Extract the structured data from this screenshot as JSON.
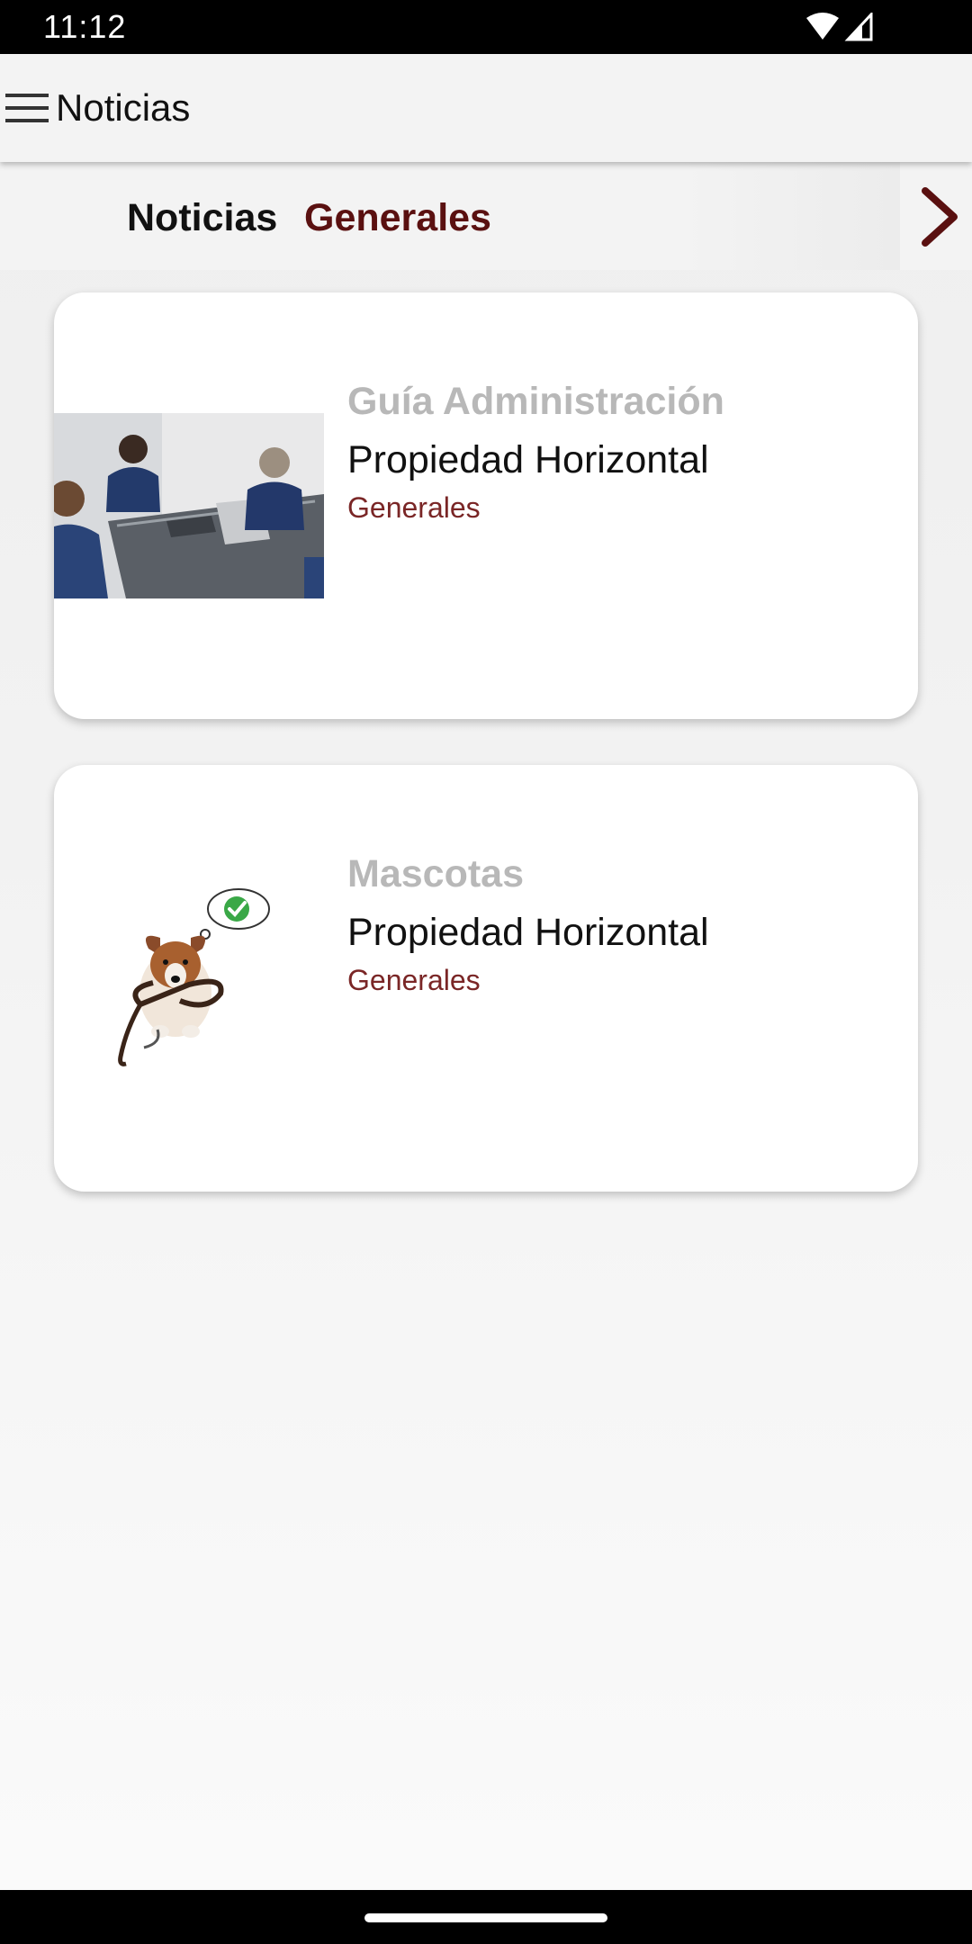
{
  "status_bar": {
    "time": "11:12",
    "icons": [
      "wifi-icon",
      "signal-icon"
    ]
  },
  "app_bar": {
    "title": "Noticias",
    "menu_icon": "menu-icon"
  },
  "tabs": {
    "items": [
      {
        "label": "Noticias",
        "selected": false
      },
      {
        "label": "Generales",
        "selected": true
      }
    ],
    "next_icon": "chevron-right-icon"
  },
  "news": [
    {
      "title": "Guía Administración",
      "subtitle": "Propiedad Horizontal",
      "category": "Generales",
      "image": "meeting-photo"
    },
    {
      "title": "Mascotas",
      "subtitle": "Propiedad Horizontal",
      "category": "Generales",
      "image": "dog-with-leash-illustration"
    }
  ],
  "colors": {
    "accent": "#5a1010",
    "category": "#7a2626",
    "title_muted": "#b8b8b8",
    "background": "#f2f2f2"
  }
}
